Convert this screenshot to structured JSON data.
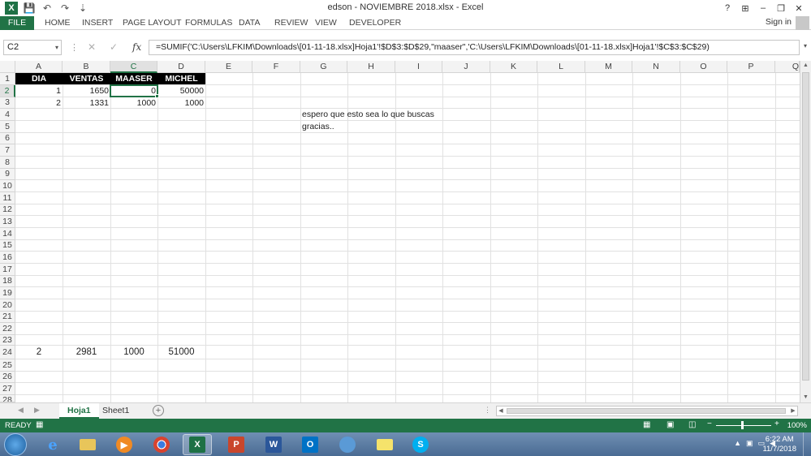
{
  "window": {
    "title": "edson - NOVIEMBRE 2018.xlsx - Excel",
    "help": "?",
    "ribbon_options": "⊞",
    "minimize": "–",
    "restore": "❐",
    "close": "✕"
  },
  "quick_access": {
    "logo": "X",
    "save": "💾",
    "undo": "↶",
    "redo": "↷",
    "customize": "⇣"
  },
  "ribbon": {
    "tabs": [
      "FILE",
      "HOME",
      "INSERT",
      "PAGE LAYOUT",
      "FORMULAS",
      "DATA",
      "REVIEW",
      "VIEW",
      "DEVELOPER"
    ],
    "sign_in": "Sign in"
  },
  "formula_bar": {
    "name_box": "C2",
    "dropdown": "▾",
    "more": "⋮",
    "cancel": "✕",
    "enter": "✓",
    "fx": "fx",
    "formula": "=SUMIF('C:\\Users\\LFKIM\\Downloads\\[01-11-18.xlsx]Hoja1'!$D$3:$D$29,\"maaser\",'C:\\Users\\LFKIM\\Downloads\\[01-11-18.xlsx]Hoja1'!$C$3:$C$29)"
  },
  "columns": [
    "A",
    "B",
    "C",
    "D",
    "E",
    "F",
    "G",
    "H",
    "I",
    "J",
    "K",
    "L",
    "M",
    "N",
    "O",
    "P",
    "Q"
  ],
  "selected_column": "C",
  "rows": [
    "1",
    "2",
    "3",
    "4",
    "5",
    "6",
    "7",
    "8",
    "9",
    "10",
    "11",
    "12",
    "13",
    "14",
    "15",
    "16",
    "17",
    "18",
    "19",
    "20",
    "21",
    "22",
    "23",
    "24",
    "25",
    "26",
    "27",
    "28"
  ],
  "selected_row": "2",
  "sheet": {
    "header": [
      "DIA",
      "VENTAS",
      "MAASER",
      "MICHEL"
    ],
    "row2": [
      "1",
      "1650",
      "0",
      "50000"
    ],
    "row3": [
      "2",
      "1331",
      "1000",
      "1000"
    ],
    "note_line1": "espero que esto sea lo que buscas",
    "note_line2": "gracias..",
    "row24": [
      "2",
      "2981",
      "1000",
      "51000"
    ]
  },
  "sheet_tabs": {
    "nav_prev": "◀",
    "nav_next": "▶",
    "tabs": [
      "Hoja1",
      "Sheet1"
    ],
    "active": "Hoja1",
    "add": "+",
    "hscroll_more": "⋮"
  },
  "status_bar": {
    "status": "READY",
    "zoom_minus": "−",
    "zoom_plus": "+",
    "zoom": "100%"
  },
  "taskbar": {
    "apps": [
      "internet-explorer",
      "file-explorer",
      "media-player",
      "chrome",
      "excel",
      "powerpoint",
      "word",
      "outlook",
      "app-9",
      "sticky-notes",
      "skype"
    ],
    "active_app": "excel",
    "time": "6:22 AM",
    "date": "11/7/2018"
  },
  "colors": {
    "excel_green": "#217346",
    "header_fill": "#000000",
    "taskbar": "#4a6b93"
  }
}
